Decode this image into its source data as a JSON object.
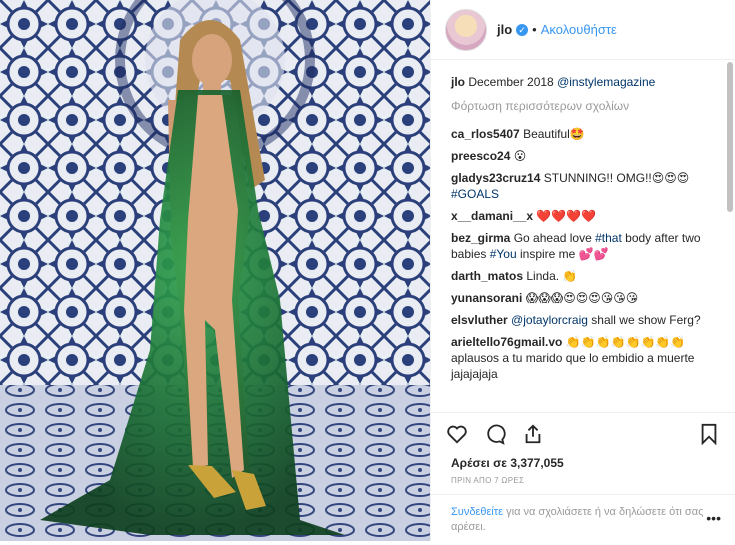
{
  "account": {
    "username": "jlo",
    "follow_label": "Ακολουθήστε",
    "dot": "•"
  },
  "caption": {
    "user": "jlo",
    "text": "December 2018",
    "mention": "@instylemagazine"
  },
  "load_more": "Φόρτωση περισσότερων σχολίων",
  "comments": [
    {
      "user": "ca_rlos5407",
      "text": "Beautiful🤩"
    },
    {
      "user": "preesco24",
      "text": "😮"
    },
    {
      "user": "gladys23cruz14",
      "text": "STUNNING!! OMG!!😍😍😍",
      "text2": "#GOALS"
    },
    {
      "user": "x__damani__x",
      "text": "❤️❤️❤️❤️"
    },
    {
      "user": "bez_girma",
      "text": "Go ahead love",
      "tag": "#that",
      "text_b": "body after two babies",
      "tag2": "#You",
      "text_c": "inspire me 💕💕"
    },
    {
      "user": "darth_matos",
      "text": "Linda. 👏"
    },
    {
      "user": "yunansorani",
      "text": "😱😱😱😍😍😍😘😘😘"
    },
    {
      "user": "elsvluther",
      "mention": "@jotaylorcraig",
      "text": "shall we show Ferg?"
    },
    {
      "user": "arieltello76gmail.vo",
      "text": "👏👏👏👏👏👏👏👏",
      "text2": "aplausos a tu marido que lo embidio a muerte jajajajaja"
    }
  ],
  "likes": "Αρέσει σε 3,377,055",
  "time": "ΠΡΙΝ ΑΠΟ 7 ΩΡΕΣ",
  "login": {
    "link": "Συνδεθείτε",
    "text": "για να σχολιάσετε ή να δηλώσετε ότι σας αρέσει."
  },
  "icons": [
    "heart-icon",
    "comment-icon",
    "share-icon",
    "bookmark-icon",
    "more-icon",
    "verified-icon"
  ],
  "colors": {
    "link": "#3897f0",
    "mention": "#003569",
    "verified": "#3897f0",
    "dress": "#1e7a3a"
  }
}
